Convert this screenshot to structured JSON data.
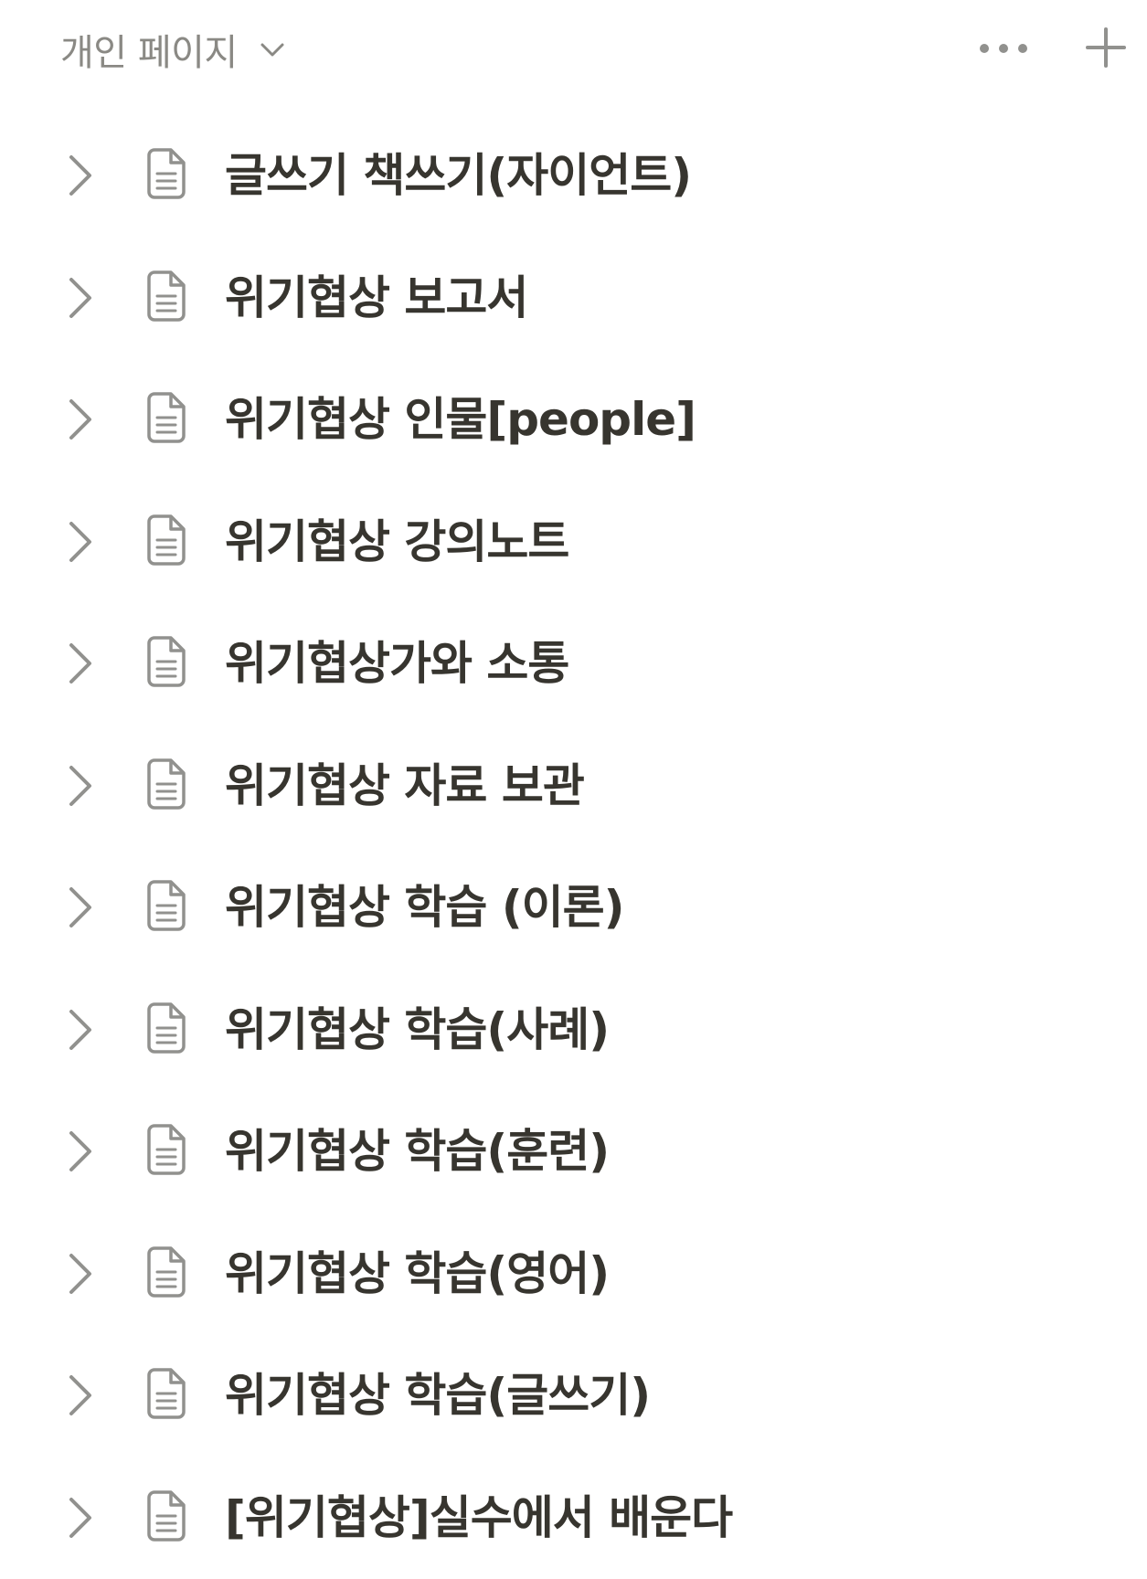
{
  "sidebar": {
    "section_title": "개인 페이지",
    "icons": {
      "section_toggle": "chevron-down-icon",
      "more": "ellipsis-icon",
      "add": "plus-icon",
      "expand": "chevron-right-icon",
      "page": "page-document-icon"
    },
    "colors": {
      "text": "#37352f",
      "muted": "#8a8984",
      "icon": "#91918e"
    },
    "pages": [
      {
        "title": "글쓰기 책쓰기(자이언트)"
      },
      {
        "title": "위기협상 보고서"
      },
      {
        "title": "위기협상 인물[people]"
      },
      {
        "title": "위기협상 강의노트"
      },
      {
        "title": "위기협상가와 소통"
      },
      {
        "title": "위기협상 자료 보관"
      },
      {
        "title": "위기협상 학습 (이론)"
      },
      {
        "title": "위기협상 학습(사례)"
      },
      {
        "title": "위기협상 학습(훈련)"
      },
      {
        "title": "위기협상 학습(영어)"
      },
      {
        "title": "위기협상 학습(글쓰기)"
      },
      {
        "title": "[위기협상]실수에서 배운다"
      }
    ]
  }
}
